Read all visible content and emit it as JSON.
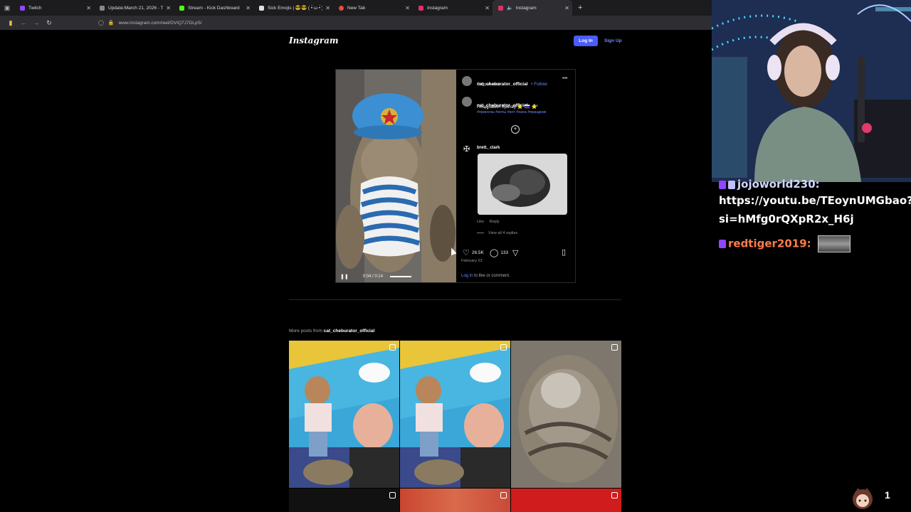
{
  "browser": {
    "tabs": [
      {
        "title": "Twitch",
        "color": "#9146ff"
      },
      {
        "title": "Update:March 21, 2026 - The E",
        "color": "#888888"
      },
      {
        "title": "Stream - Kick Dashboard",
        "color": "#53fc18"
      },
      {
        "title": "Sick Emojis | 😎😎 ( •̀ ω •́ )✧ 🌀✨",
        "color": "#e0e0e0"
      },
      {
        "title": "New Tab",
        "color": "#e94b3c"
      },
      {
        "title": "Instagram",
        "color": "#e1306c"
      },
      {
        "title": "Instagram",
        "color": "#e1306c"
      }
    ],
    "url": "www.instagram.com/reel/DVIQ7J7DLpS/",
    "new_tab": "+"
  },
  "instagram": {
    "logo": "Instagram",
    "login": "Log In",
    "signup": "Sign Up"
  },
  "post": {
    "username": "cat_cheburator_official",
    "follow": "• Follow",
    "audio": "Original audio",
    "more": "•••",
    "caption_user": "cat_cheburator_official",
    "caption_age": "3w",
    "caption_text": "Поздравил братву ⭐ 🇷🇺 ⭐",
    "caption_tags": "#приколы #коты #кот #хаха #праздник",
    "commenter": "brett._clark",
    "like": "Like",
    "reply": "Reply",
    "view_replies": "View all 4 replies",
    "likes": "26.5K",
    "comments": "133",
    "date": "February 23",
    "login_prompt_link": "Log in",
    "login_prompt_rest": " to like or comment.",
    "video_time": "0:04 / 0:14"
  },
  "more_posts": {
    "label": "More posts from ",
    "user": "cat_cheburator_official"
  },
  "stream": {
    "chat": [
      {
        "user": "jojoworld230:",
        "text": ""
      },
      {
        "user": "",
        "text": "https://youtu.be/TEoynUMGbao?"
      },
      {
        "user": "",
        "text": "si=hMfg0rQXpR2x_H6j"
      },
      {
        "user": "redtiger2019:",
        "text": ""
      }
    ],
    "viewer_count": "1"
  }
}
